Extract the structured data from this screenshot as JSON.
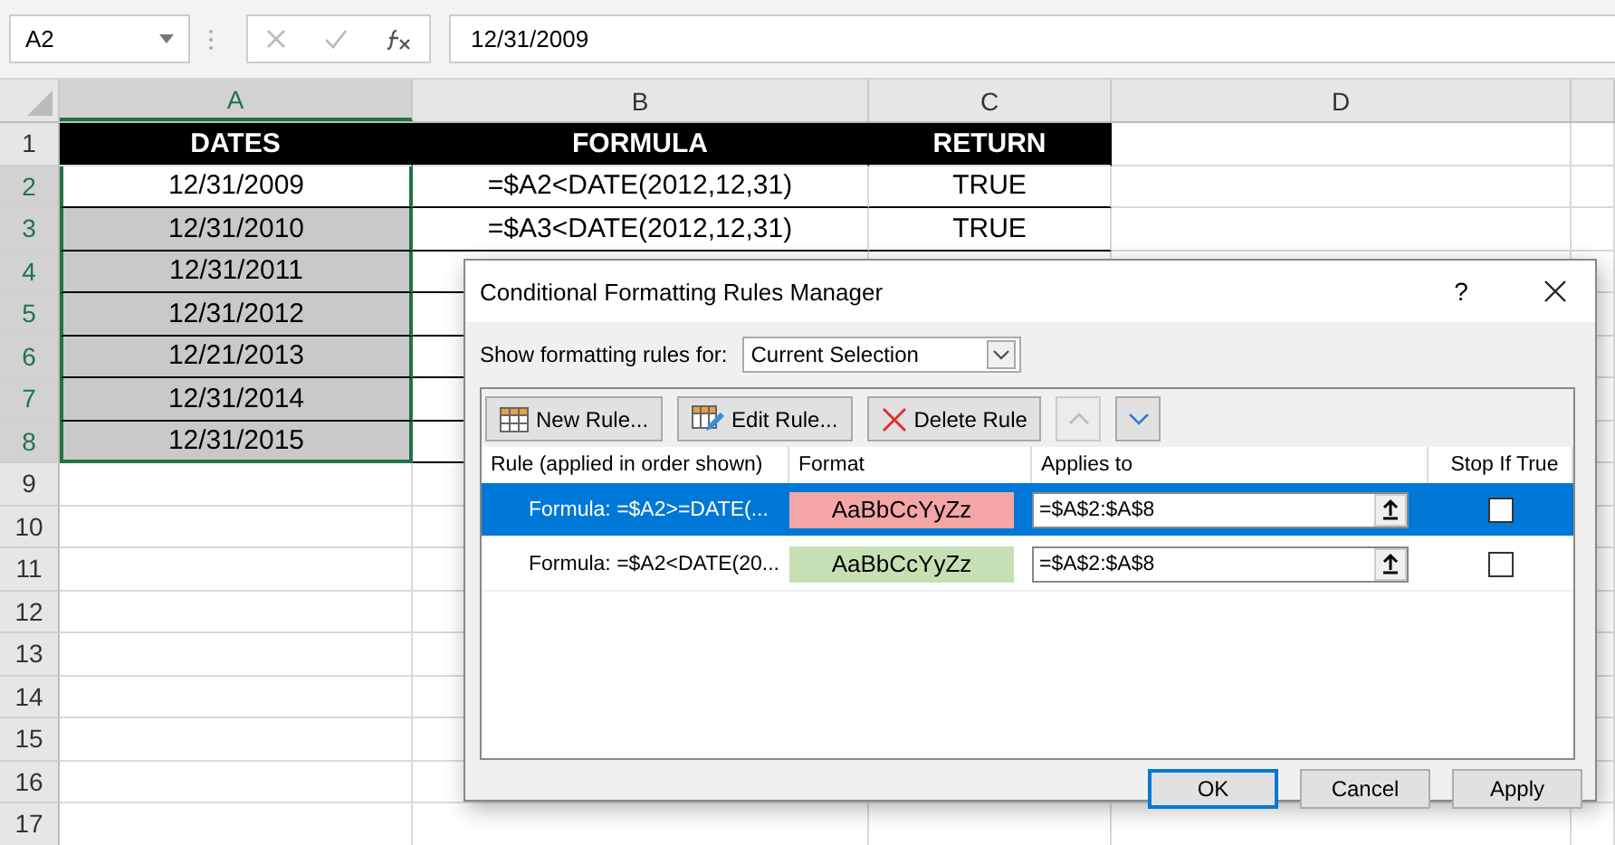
{
  "name_box": {
    "value": "A2"
  },
  "formula_bar": {
    "value": "12/31/2009"
  },
  "columns": [
    {
      "label": "A",
      "selected": true
    },
    {
      "label": "B",
      "selected": false
    },
    {
      "label": "C",
      "selected": false
    },
    {
      "label": "D",
      "selected": false
    }
  ],
  "rows": [
    {
      "label": "1",
      "selected": false,
      "kind": "header",
      "cells": [
        {
          "text": "DATES"
        },
        {
          "text": "FORMULA"
        },
        {
          "text": "RETURN"
        }
      ]
    },
    {
      "label": "2",
      "selected": true,
      "kind": "data",
      "cells": [
        {
          "text": "12/31/2009",
          "shaded": false
        },
        {
          "text": "=$A2<DATE(2012,12,31)",
          "shaded": false
        },
        {
          "text": "TRUE",
          "shaded": false
        }
      ]
    },
    {
      "label": "3",
      "selected": true,
      "kind": "data",
      "cells": [
        {
          "text": "12/31/2010",
          "shaded": true
        },
        {
          "text": "=$A3<DATE(2012,12,31)",
          "shaded": false
        },
        {
          "text": "TRUE",
          "shaded": false
        }
      ]
    },
    {
      "label": "4",
      "selected": true,
      "kind": "data",
      "cells": [
        {
          "text": "12/31/2011",
          "shaded": true
        }
      ]
    },
    {
      "label": "5",
      "selected": true,
      "kind": "data",
      "cells": [
        {
          "text": "12/31/2012",
          "shaded": true
        }
      ]
    },
    {
      "label": "6",
      "selected": true,
      "kind": "data",
      "cells": [
        {
          "text": "12/21/2013",
          "shaded": true
        }
      ]
    },
    {
      "label": "7",
      "selected": true,
      "kind": "data",
      "cells": [
        {
          "text": "12/31/2014",
          "shaded": true
        }
      ]
    },
    {
      "label": "8",
      "selected": true,
      "kind": "data",
      "cells": [
        {
          "text": "12/31/2015",
          "shaded": true
        }
      ]
    },
    {
      "label": "9",
      "selected": false,
      "kind": "empty"
    },
    {
      "label": "10",
      "selected": false,
      "kind": "empty"
    },
    {
      "label": "11",
      "selected": false,
      "kind": "empty"
    },
    {
      "label": "12",
      "selected": false,
      "kind": "empty"
    },
    {
      "label": "13",
      "selected": false,
      "kind": "empty"
    },
    {
      "label": "14",
      "selected": false,
      "kind": "empty"
    },
    {
      "label": "15",
      "selected": false,
      "kind": "empty"
    },
    {
      "label": "16",
      "selected": false,
      "kind": "empty"
    },
    {
      "label": "17",
      "selected": false,
      "kind": "empty"
    }
  ],
  "dialog": {
    "title": "Conditional Formatting Rules Manager",
    "help": "?",
    "show_label": "Show formatting rules for:",
    "show_value": "Current Selection",
    "toolbar": [
      {
        "kind": "new",
        "label": "New Rule...",
        "disabled": false
      },
      {
        "kind": "edit",
        "label": "Edit Rule...",
        "disabled": false
      },
      {
        "kind": "delete",
        "label": "Delete Rule",
        "disabled": false
      },
      {
        "kind": "up",
        "disabled": true
      },
      {
        "kind": "down",
        "disabled": false
      }
    ],
    "columns": [
      "Rule (applied in order shown)",
      "Format",
      "Applies to",
      "Stop If True"
    ],
    "rules": [
      {
        "rule": "Formula: =$A2>=DATE(...",
        "preview": "AaBbCcYyZz",
        "color": "#f4a6a6",
        "applies_to": "=$A$2:$A$8",
        "stop_if_true": false,
        "selected": true
      },
      {
        "rule": "Formula: =$A2<DATE(20...",
        "preview": "AaBbCcYyZz",
        "color": "#c6e0b4",
        "applies_to": "=$A$2:$A$8",
        "stop_if_true": false,
        "selected": false
      }
    ],
    "buttons": [
      {
        "label": "OK",
        "default": true
      },
      {
        "label": "Cancel",
        "default": false
      },
      {
        "label": "Apply",
        "default": false
      }
    ]
  }
}
